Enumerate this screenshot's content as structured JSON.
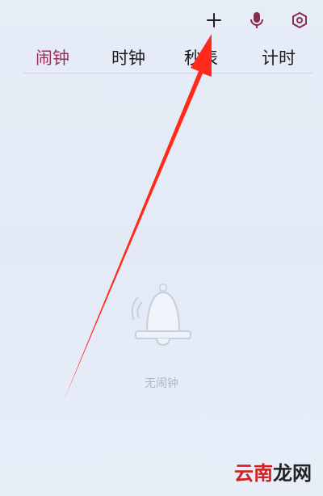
{
  "toolbar": {
    "add_icon": "plus-icon",
    "mic_icon": "microphone-icon",
    "settings_icon": "gear-icon",
    "accent_color": "#9a2d5a"
  },
  "tabs": [
    {
      "label": "闹钟",
      "active": true
    },
    {
      "label": "时钟",
      "active": false
    },
    {
      "label": "秒表",
      "active": false
    },
    {
      "label": "计时",
      "active": false
    }
  ],
  "empty_state": {
    "icon": "bell-icon",
    "text": "无闹钟"
  },
  "annotation": {
    "arrow_color": "#ff2a1a"
  },
  "watermark": {
    "part1": "云南",
    "part2": "龙网"
  }
}
